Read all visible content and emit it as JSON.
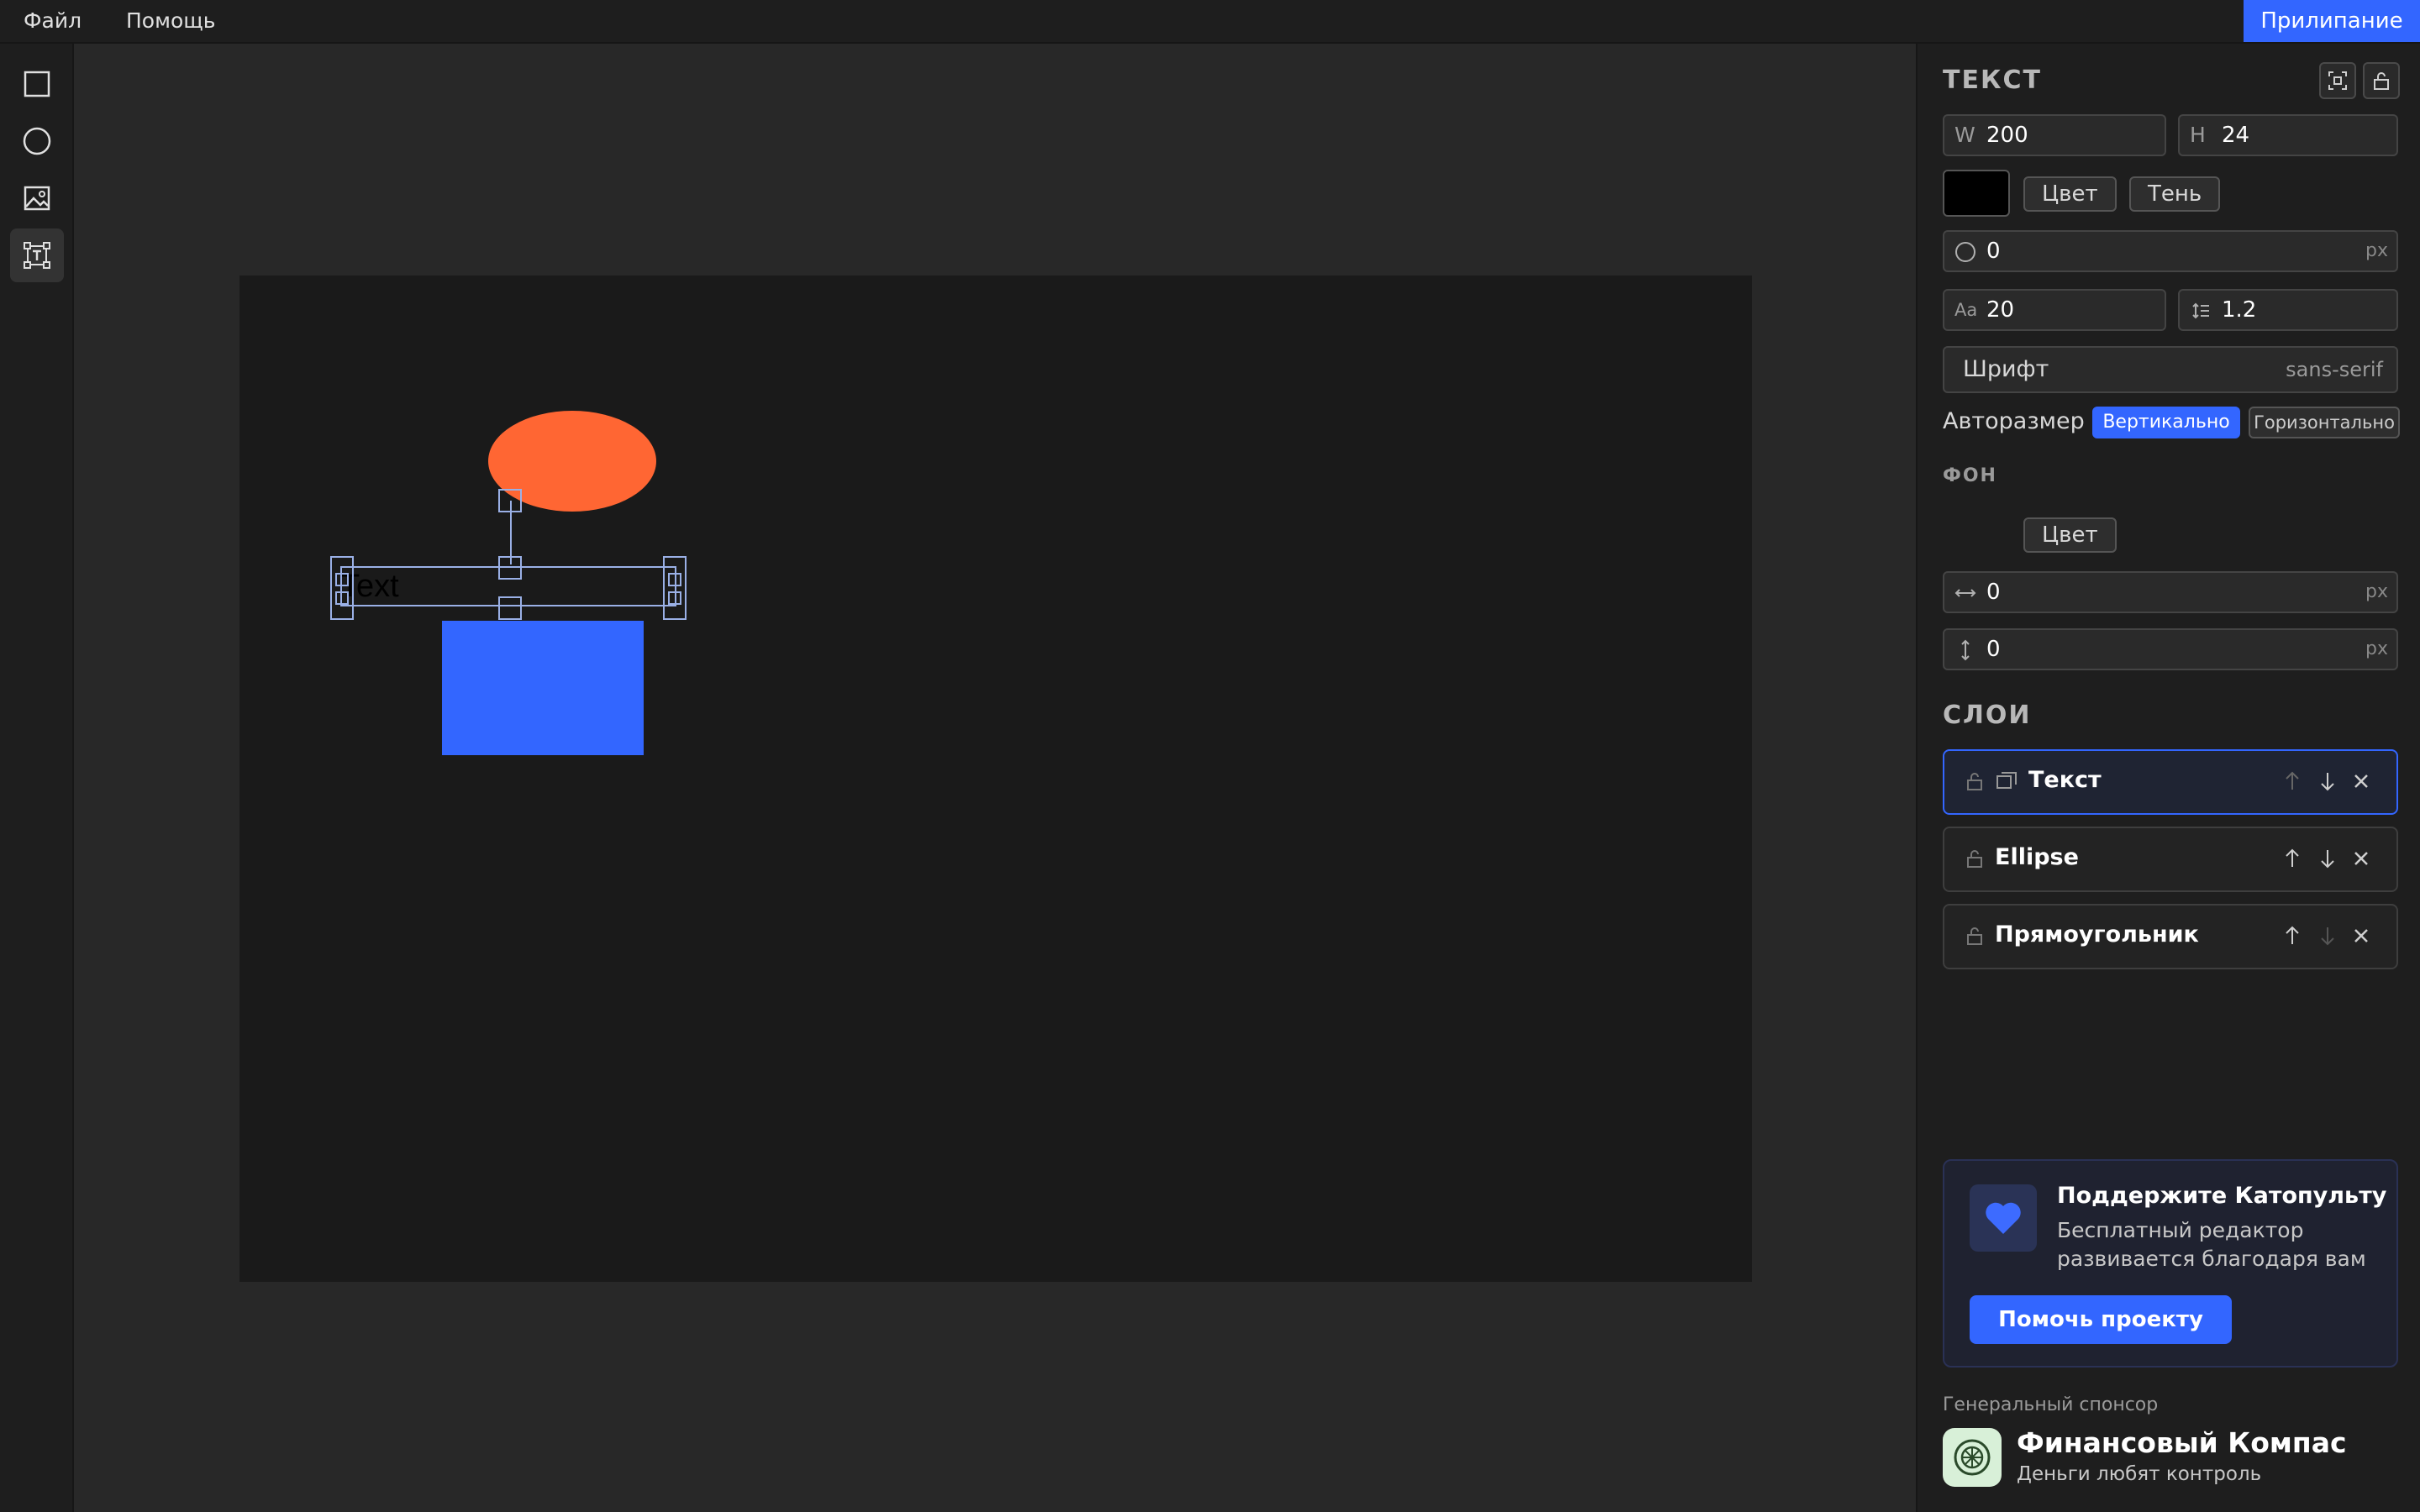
{
  "menu": {
    "file": "Файл",
    "help": "Помощь",
    "snap": "Прилипание"
  },
  "tools": [
    {
      "name": "rectangle-tool",
      "icon": "square-icon"
    },
    {
      "name": "ellipse-tool",
      "icon": "circle-icon"
    },
    {
      "name": "image-tool",
      "icon": "image-icon"
    },
    {
      "name": "text-tool",
      "icon": "text-frame-icon",
      "active": true
    }
  ],
  "canvas": {
    "text_content": "Text",
    "ellipse_color": "#ff6633",
    "rect_color": "#3366ff",
    "artboard_color": "#1a1a1a"
  },
  "props": {
    "title": "ТЕКСТ",
    "width_label": "W",
    "width": "200",
    "height_label": "H",
    "height": "24",
    "fill_color": "#000000",
    "color_btn": "Цвет",
    "shadow_btn": "Тень",
    "radius": "0",
    "radius_unit": "px",
    "font_size_label": "Aa",
    "font_size": "20",
    "line_height": "1.2",
    "font_label": "Шрифт",
    "font_value": "sans-serif",
    "autosize_label": "Авторазмер",
    "autosize_vertical": "Вертикально",
    "autosize_horizontal": "Горизонтально"
  },
  "background": {
    "title": "ФОН",
    "color_btn": "Цвет",
    "padding_x": "0",
    "padding_y": "0",
    "unit": "px"
  },
  "layers": {
    "title": "СЛОИ",
    "items": [
      {
        "name": "Текст",
        "selected": true
      },
      {
        "name": "Ellipse",
        "selected": false
      },
      {
        "name": "Прямоугольник",
        "selected": false
      }
    ]
  },
  "promo": {
    "title": "Поддержите Катопульту",
    "desc": "Бесплатный редактор развивается благодаря вам",
    "cta": "Помочь проекту"
  },
  "sponsor": {
    "caption": "Генеральный спонсор",
    "name": "Финансовый Компас",
    "tagline": "Деньги любят контроль"
  },
  "colors": {
    "accent": "#3366ff",
    "panel": "#1e1e1e",
    "canvas_bg": "#282828"
  }
}
